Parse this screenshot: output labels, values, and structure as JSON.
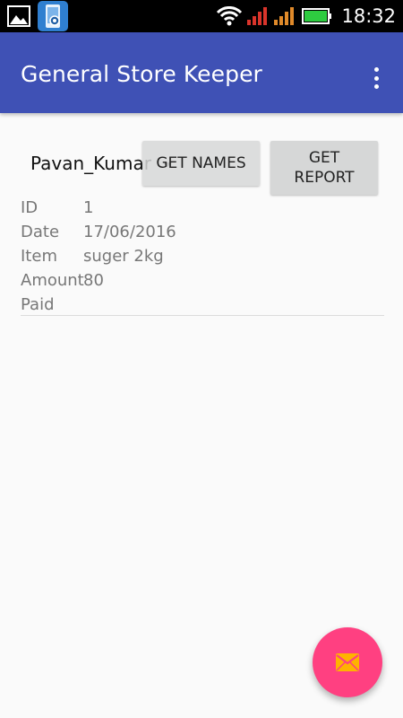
{
  "status_bar": {
    "time": "18:32",
    "icons": [
      "gallery-icon",
      "app-notification-icon",
      "wifi-icon",
      "signal-red-icon",
      "signal-orange-icon",
      "battery-icon"
    ]
  },
  "app_bar": {
    "title": "General Store Keeper",
    "overflow_icon": "more-vert-icon"
  },
  "controls": {
    "name_spinner": "Pavan_Kumar",
    "get_names_label": "GET NAMES",
    "get_report_line1": "GET",
    "get_report_line2": "REPORT"
  },
  "record": {
    "id_label": "ID",
    "id_value": "1",
    "date_label": "Date",
    "date_value": "17/06/2016",
    "item_label": "Item",
    "item_value": "suger 2kg",
    "amount_label": "Amount",
    "amount_value": "80",
    "paid_label": "Paid",
    "paid_value": ""
  },
  "fab": {
    "icon": "mail-icon"
  },
  "colors": {
    "app_bar": "#3f51b5",
    "fab": "#ff4081",
    "fab_icon": "#ffb300",
    "button": "#d6d7d7"
  }
}
